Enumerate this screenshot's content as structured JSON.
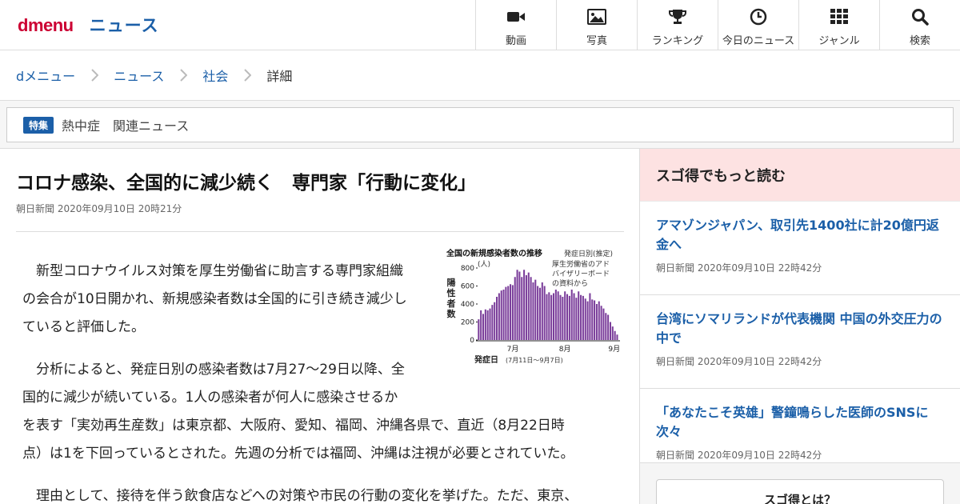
{
  "header": {
    "logo": "dmenu",
    "section": "ニュース",
    "nav": [
      {
        "label": "動画",
        "icon": "video-camera-icon"
      },
      {
        "label": "写真",
        "icon": "photo-icon"
      },
      {
        "label": "ランキング",
        "icon": "trophy-icon"
      },
      {
        "label": "今日のニュース",
        "icon": "clock-icon"
      },
      {
        "label": "ジャンル",
        "icon": "grid-icon"
      },
      {
        "label": "検索",
        "icon": "search-icon"
      }
    ]
  },
  "breadcrumb": [
    "dメニュー",
    "ニュース",
    "社会",
    "詳細"
  ],
  "feature": {
    "badge": "特集",
    "text": "熱中症　関連ニュース"
  },
  "article": {
    "title": "コロナ感染、全国的に減少続く　専門家「行動に変化」",
    "meta": "朝日新聞 2020年09月10日 20時21分",
    "paragraphs": [
      [
        "新型コロナウイルス対策を厚生労働省に助言する専門家組織",
        "の会合が10日開かれ、新規感染者数は全国的に引き続き減少し",
        "ていると評価した。"
      ],
      [
        "分析によると、発症日別の感染者数は7月27〜29日以降、全",
        "国的に減少が続いている。1人の感染者が何人に感染させるか",
        "を表す「実効再生産数」は東京都、大阪府、愛知、福岡、沖縄各県で、直近（8月22日時",
        "点）は1を下回っているとされた。先週の分析では福岡、沖縄は注視が必要とされていた。"
      ],
      [
        "理由として、接待を伴う飲食店などへの対策や市民の行動の変化を挙げた。ただ、東京、"
      ]
    ]
  },
  "figure": {
    "title": "全国の新規感染者数の推移",
    "subtitle": "発症日別(推定)",
    "note": [
      "厚生労働省のアド",
      "バイザリーボード",
      "の資料から"
    ],
    "unit": "(人)",
    "ylabel": [
      "陽",
      "性",
      "者",
      "数"
    ],
    "yticks": [
      "800",
      "600",
      "400",
      "200",
      "0"
    ],
    "xticks": [
      "7月",
      "8月",
      "9月"
    ],
    "xlabel": "発症日",
    "xlabel_note": "(7月11日〜9月7日)",
    "bar_color": "#7a3d9a"
  },
  "chart_data": {
    "type": "bar",
    "title": "全国の新規感染者数の推移",
    "ylabel": "陽性者数",
    "xlabel": "発症日",
    "ylim": [
      0,
      800
    ],
    "values": [
      230,
      330,
      290,
      340,
      330,
      350,
      390,
      420,
      480,
      520,
      550,
      560,
      590,
      600,
      620,
      610,
      700,
      780,
      760,
      700,
      780,
      720,
      750,
      700,
      640,
      670,
      600,
      580,
      640,
      600,
      510,
      530,
      500,
      520,
      560,
      540,
      500,
      480,
      540,
      510,
      490,
      560,
      520,
      470,
      540,
      500,
      490,
      460,
      430,
      520,
      450,
      440,
      400,
      430,
      380,
      350,
      300,
      280,
      200,
      150,
      100,
      60
    ]
  },
  "sidebar": {
    "title": "スゴ得でもっと読む",
    "items": [
      {
        "title": "アマゾンジャパン、取引先1400社に計20億円返金へ",
        "meta": "朝日新聞 2020年09月10日 22時42分"
      },
      {
        "title": "台湾にソマリランドが代表機関 中国の外交圧力の中で",
        "meta": "朝日新聞 2020年09月10日 22時42分"
      },
      {
        "title": "「あなたこそ英雄」警鐘鳴らした医師のSNSに次々",
        "meta": "朝日新聞 2020年09月10日 22時42分"
      }
    ],
    "about_label": "スゴ得とは？"
  }
}
